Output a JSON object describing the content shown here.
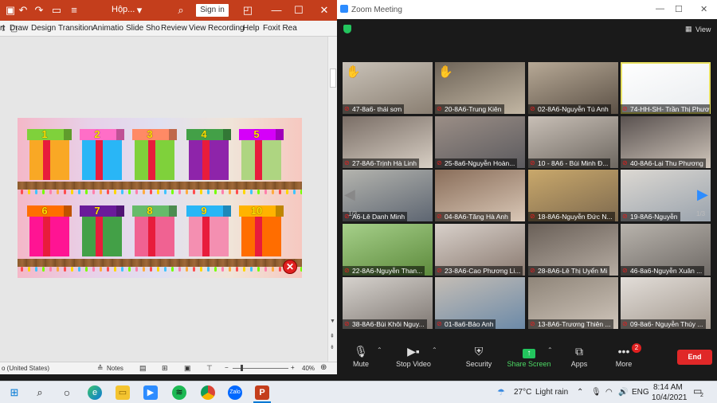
{
  "ppt": {
    "title": "Hộp...",
    "signin_label": "Sign in",
    "tabs": [
      "rt",
      "Draw",
      "Design",
      "Transition",
      "Animatio",
      "Slide Sho",
      "Review",
      "View",
      "Recording",
      "Help",
      "Foxit Rea"
    ],
    "status": {
      "language": "o (United States)",
      "notes_label": "Notes",
      "zoom_level": "40%",
      "zoom_minus": "−",
      "zoom_plus": "+"
    },
    "slide": {
      "gift_numbers": [
        "1",
        "2",
        "3",
        "4",
        "5",
        "6",
        "7",
        "8",
        "9",
        "10"
      ],
      "close_glyph": "✕"
    }
  },
  "zoom": {
    "window_title": "Zoom Meeting",
    "view_label": "View",
    "page_left": "1/3",
    "page_right": "1/3",
    "participants": [
      {
        "label": "47-8a6- thái  sơn",
        "hand": true,
        "active": false
      },
      {
        "label": "20-8A6-Trung Kiên",
        "hand": true,
        "active": false
      },
      {
        "label": "02-8A6-Nguyễn Tú Anh",
        "hand": false,
        "active": false
      },
      {
        "label": "74-HH-SH- Trần Thị Phươ",
        "hand": false,
        "active": true
      },
      {
        "label": "27-8A6-Trịnh Hà Linh",
        "hand": false,
        "active": false
      },
      {
        "label": "25-8a6-Nguyễn Hoàn...",
        "hand": false,
        "active": false
      },
      {
        "label": "10 - 8A6 - Bùi Minh Đ...",
        "hand": false,
        "active": false
      },
      {
        "label": "40-8A6-Lại Thu Phương",
        "hand": false,
        "active": false
      },
      {
        "label": "A6-Lê Danh Minh",
        "hand": false,
        "active": false
      },
      {
        "label": "04-8A6-Tăng Hà Anh",
        "hand": false,
        "active": false
      },
      {
        "label": "18-8A6-Nguyễn Đức N...",
        "hand": false,
        "active": false
      },
      {
        "label": "19-8A6-Nguyễn",
        "hand": false,
        "active": false
      },
      {
        "label": "22-8A6-Nguyễn Than...",
        "hand": false,
        "active": false
      },
      {
        "label": "23-8A6-Cao Phương Li...",
        "hand": false,
        "active": false
      },
      {
        "label": "28-8A6-Lê Thị Uyển Mi",
        "hand": false,
        "active": false
      },
      {
        "label": "46-8a6-Nguyễn Xuân ...",
        "hand": false,
        "active": false
      },
      {
        "label": "38-8A6-Bùi Khôi Nguy...",
        "hand": false,
        "active": false
      },
      {
        "label": "01-8a6-Bảo Anh",
        "hand": false,
        "active": false
      },
      {
        "label": "13-8A6-Trương Thiên ...",
        "hand": false,
        "active": false
      },
      {
        "label": "09-8a6- Nguyễn Thúy ...",
        "hand": false,
        "active": false
      }
    ],
    "controls": [
      {
        "label": "Mute",
        "icon": "microphone-icon"
      },
      {
        "label": "Stop Video",
        "icon": "video-camera-icon"
      },
      {
        "label": "Security",
        "icon": "shield-icon"
      },
      {
        "label": "Share Screen",
        "icon": "share-screen-icon"
      },
      {
        "label": "Apps",
        "icon": "apps-icon"
      },
      {
        "label": "More",
        "icon": "more-icon"
      }
    ],
    "more_badge": "2",
    "end_label": "End"
  },
  "taskbar": {
    "weather_temp": "27°C",
    "weather_text": "Light rain",
    "language": "ENG",
    "time": "8:14 AM",
    "date": "10/4/2021",
    "notification_count": "2"
  },
  "colors": {
    "ppt_accent": "#c43e1c",
    "zoom_bg": "#1a1a1a",
    "share_green": "#4cd964",
    "end_red": "#e02828"
  }
}
